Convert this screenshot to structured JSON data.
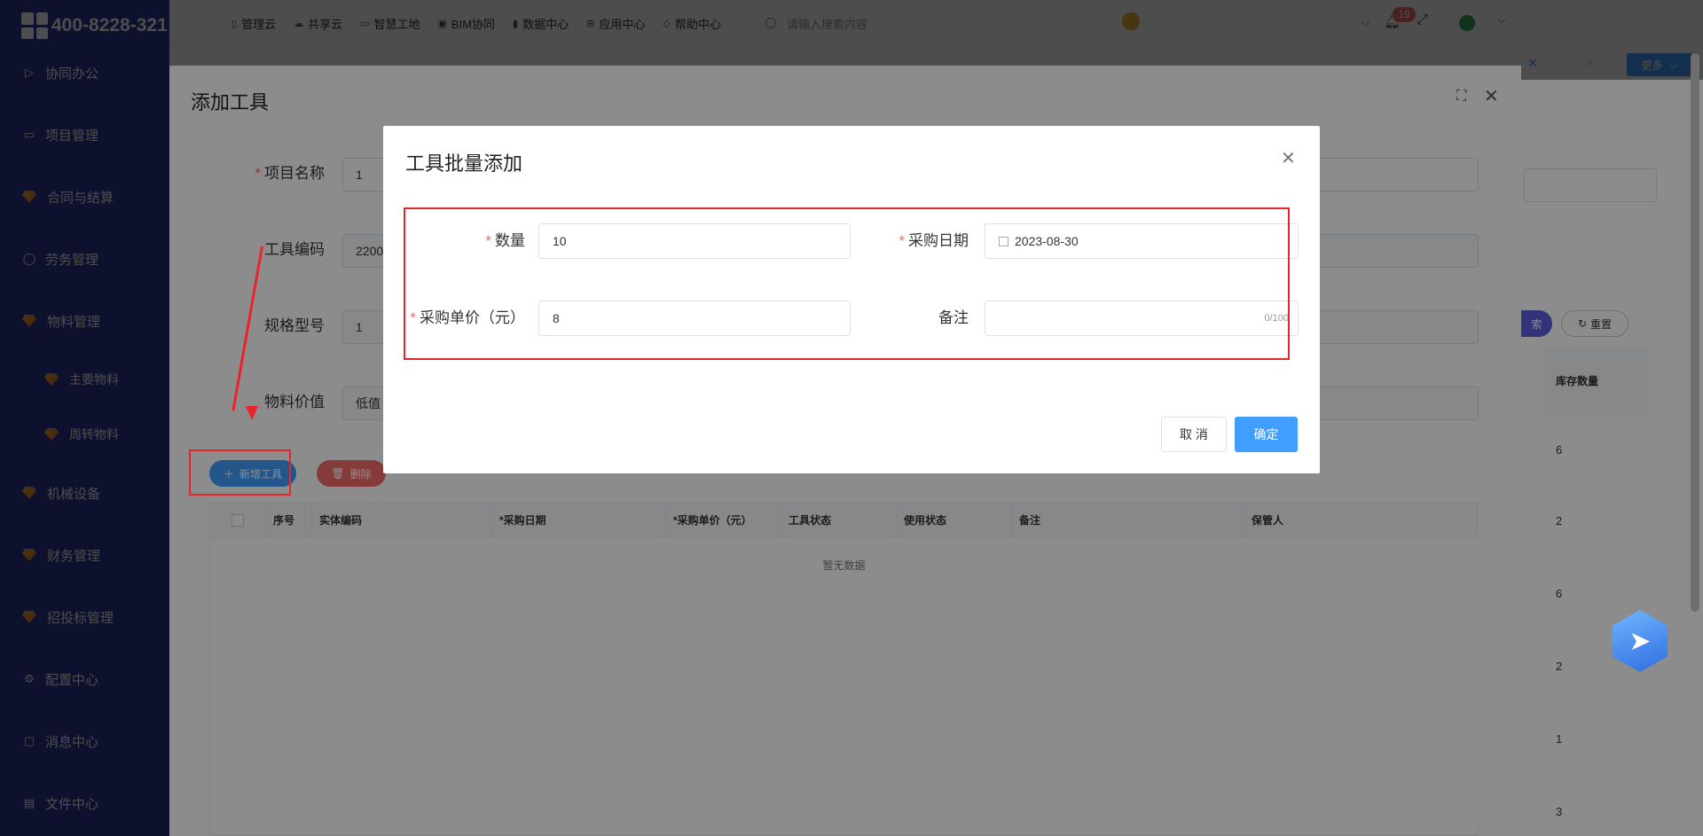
{
  "sidebar": {
    "phone": "400-8228-321",
    "items": [
      {
        "label": "协同办公",
        "icon": "send-icon"
      },
      {
        "label": "项目管理",
        "icon": "book-icon"
      },
      {
        "label": "合同与结算",
        "icon": "gem-icon"
      },
      {
        "label": "劳务管理",
        "icon": "user-icon"
      },
      {
        "label": "物料管理",
        "icon": "gem-icon"
      },
      {
        "label": "主要物料",
        "icon": "gem-icon"
      },
      {
        "label": "周转物料",
        "icon": "gem-icon"
      },
      {
        "label": "机械设备",
        "icon": "gem-icon"
      },
      {
        "label": "财务管理",
        "icon": "gem-icon"
      },
      {
        "label": "招投标管理",
        "icon": "gem-icon"
      },
      {
        "label": "配置中心",
        "icon": "gear-icon"
      },
      {
        "label": "消息中心",
        "icon": "message-icon"
      },
      {
        "label": "文件中心",
        "icon": "file-icon"
      }
    ]
  },
  "topbar": {
    "nav": [
      "管理云",
      "共享云",
      "智慧工地",
      "BIM协同",
      "数据中心",
      "应用中心",
      "帮助中心"
    ],
    "search_placeholder": "请输入搜索内容",
    "notification_count": "19",
    "more_label": "更多"
  },
  "drawer": {
    "title": "添加工具",
    "fields": {
      "project_name_label": "项目名称",
      "project_name_value": "1",
      "tool_code_label": "工具编码",
      "tool_code_value": "2200",
      "spec_label": "规格型号",
      "spec_value": "1",
      "material_value_label": "物料价值",
      "material_value_value": "低值"
    },
    "add_button": "新增工具",
    "delete_button": "删除",
    "table": {
      "headers": [
        "序号",
        "实体编码",
        "*采购日期",
        "*采购单价（元）",
        "工具状态",
        "使用状态",
        "备注",
        "保管人"
      ],
      "empty_text": "暂无数据"
    }
  },
  "right_column": {
    "reset_label": "重置",
    "search_label_partial": "索",
    "header": "库存数量",
    "values": [
      "6",
      "2",
      "6",
      "2",
      "1",
      "3"
    ]
  },
  "dialog": {
    "title": "工具批量添加",
    "quantity_label": "数量",
    "quantity_value": "10",
    "purchase_date_label": "采购日期",
    "purchase_date_value": "2023-08-30",
    "unit_price_label": "采购单价（元）",
    "unit_price_value": "8",
    "remark_label": "备注",
    "remark_value": "",
    "remark_counter": "0/100",
    "cancel_label": "取 消",
    "ok_label": "确定"
  },
  "colors": {
    "sidebar_bg": "#2d3a9a",
    "primary": "#409eff",
    "danger": "#f56c6c",
    "annotation": "#e8232a"
  }
}
